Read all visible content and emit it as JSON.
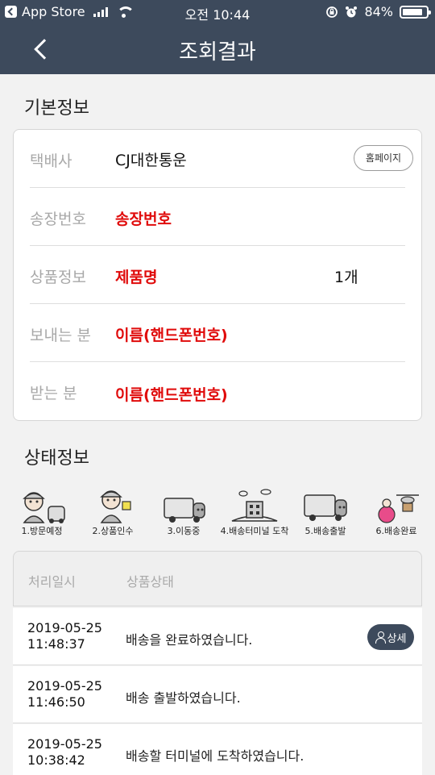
{
  "statusbar": {
    "back_app": "App Store",
    "time": "오전 10:44",
    "battery_percent": "84%",
    "battery_level": 0.84
  },
  "nav": {
    "title": "조회결과"
  },
  "basic_info": {
    "section_title": "기본정보",
    "homepage_label": "홈페이지",
    "rows": [
      {
        "label": "택배사",
        "value": "CJ대한통운"
      },
      {
        "label": "송장번호",
        "value": "송장번호"
      },
      {
        "label": "상품정보",
        "value": "제품명",
        "quantity": "1개"
      },
      {
        "label": "보내는 분",
        "value": "이름(핸드폰번호)"
      },
      {
        "label": "받는 분",
        "value": "이름(핸드폰번호)"
      }
    ]
  },
  "status_info": {
    "section_title": "상태정보",
    "steps": [
      {
        "label": "1.방문예정",
        "icon": "courier-visit-icon"
      },
      {
        "label": "2.상품인수",
        "icon": "courier-receive-icon"
      },
      {
        "label": "3.이동중",
        "icon": "truck-moving-icon"
      },
      {
        "label": "4.배송터미널 도착",
        "icon": "terminal-building-icon"
      },
      {
        "label": "5.배송출발",
        "icon": "truck-depart-icon"
      },
      {
        "label": "6.배송완료",
        "icon": "drone-delivered-icon"
      }
    ],
    "table": {
      "col_time": "처리일시",
      "col_status": "상품상태",
      "detail_label": "상세",
      "rows": [
        {
          "date": "2019-05-25",
          "time": "11:48:37",
          "status": "배송을 완료하였습니다."
        },
        {
          "date": "2019-05-25",
          "time": "11:46:50",
          "status": "배송 출발하였습니다."
        },
        {
          "date": "2019-05-25",
          "time": "10:38:42",
          "status": "배송할 터미널에 도착하였습니다."
        }
      ]
    }
  },
  "colors": {
    "header_bg": "#3d4a5c",
    "highlight_red": "#e00b0b",
    "label_gray": "#a8a8a8"
  }
}
